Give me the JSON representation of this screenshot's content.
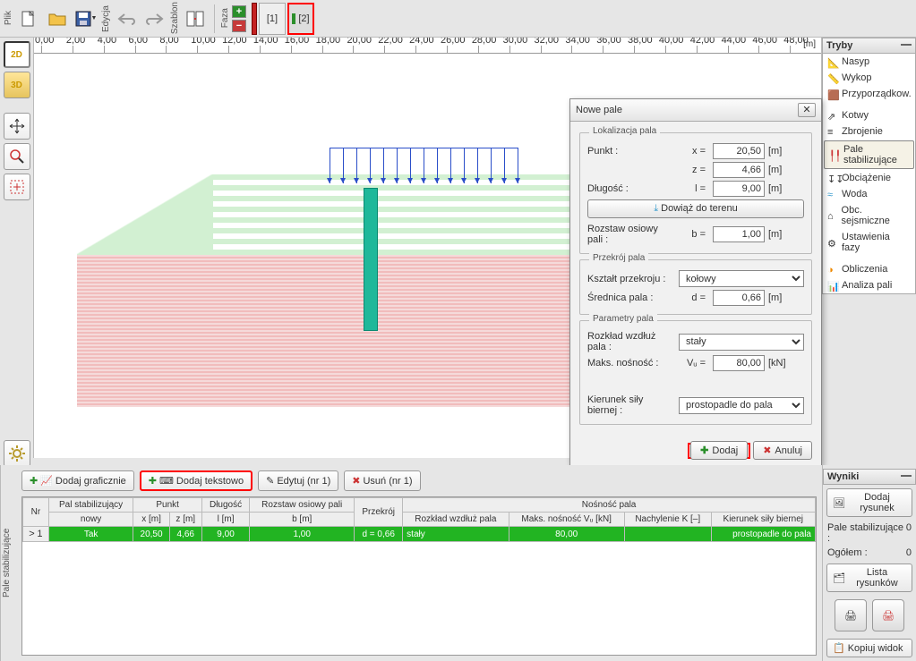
{
  "toolbar_labels": {
    "plik": "Plik",
    "edycja": "Edycja",
    "szablon": "Szablon",
    "faza": "Faza"
  },
  "phases": {
    "p1": "[1]",
    "p2": "[2]"
  },
  "ruler": {
    "unit": "[m]",
    "ticks": [
      "0,00",
      "2,00",
      "4,00",
      "6,00",
      "8,00",
      "10,00",
      "12,00",
      "14,00",
      "16,00",
      "18,00",
      "20,00",
      "22,00",
      "24,00",
      "26,00",
      "28,00",
      "30,00",
      "32,00",
      "34,00",
      "36,00",
      "38,00",
      "40,00",
      "42,00",
      "44,00",
      "46,00",
      "48,00"
    ]
  },
  "modes": {
    "title": "Tryby",
    "items": [
      "Nasyp",
      "Wykop",
      "Przyporządkow.",
      "Kotwy",
      "Zbrojenie",
      "Pale stabilizujące",
      "Obciążenie",
      "Woda",
      "Obc. sejsmiczne",
      "Ustawienia fazy",
      "Obliczenia",
      "Analiza pali"
    ],
    "sel_index": 5
  },
  "results": {
    "title": "Wyniki",
    "add": "Dodaj rysunek",
    "r1l": "Pale stabilizujące :",
    "r1v": "0",
    "r2l": "Ogółem :",
    "r2v": "0",
    "list": "Lista rysunków",
    "copy": "Kopiuj widok"
  },
  "dialog": {
    "title": "Nowe pale",
    "g1": "Lokalizacja pala",
    "punkt": "Punkt :",
    "xeq": "x =",
    "xval": "20,50",
    "mu": "[m]",
    "zeq": "z =",
    "zval": "4,66",
    "dlugosc": "Długość :",
    "leq": "l =",
    "lval": "9,00",
    "dowiaz": "Dowiąż do terenu",
    "rozstaw": "Rozstaw osiowy pali :",
    "beq": "b =",
    "bval": "1,00",
    "g2": "Przekrój pala",
    "ksztalt": "Kształt przekroju :",
    "ksztalt_val": "kołowy",
    "srednica": "Średnica pala :",
    "deq": "d =",
    "dval": "0,66",
    "g3": "Parametry pala",
    "rozklad": "Rozkład wzdłuż pala :",
    "rozklad_val": "stały",
    "maks": "Maks. nośność :",
    "veq": "Vᵤ =",
    "vval": "80,00",
    "kn": "[kN]",
    "kierunek": "Kierunek siły biernej :",
    "kierunek_val": "prostopadle do pala",
    "ok": "Dodaj",
    "cancel": "Anuluj"
  },
  "bottom": {
    "side": "Pale stabilizujące",
    "b1": "Dodaj graficznie",
    "b2": "Dodaj tekstowo",
    "b3": "Edytuj (nr 1)",
    "b4": "Usuń (nr 1)",
    "hdr": {
      "nr": "Nr",
      "pal": "Pal stabilizujący",
      "nowy": "nowy",
      "punkt": "Punkt",
      "xm": "x [m]",
      "zm": "z [m]",
      "dl": "Długość",
      "lm": "l [m]",
      "roz": "Rozstaw osiowy pali",
      "bm": "b [m]",
      "prz": "Przekrój",
      "nos": "Nośność pala",
      "rwp": "Rozkład wzdłuż pala",
      "mvu": "Maks. nośność Vᵤ [kN]",
      "nk": "Nachylenie K [–]",
      "ksb": "Kierunek siły biernej"
    },
    "row": {
      "nr": "1",
      "pal": "Tak",
      "x": "20,50",
      "z": "4,66",
      "l": "9,00",
      "b": "1,00",
      "prz": "d = 0,66",
      "rwp": "stały",
      "mvu": "80,00",
      "nk": "",
      "ksb": "prostopadle do pala",
      "marker": ">"
    }
  },
  "left": {
    "t2d": "2D",
    "t3d": "3D"
  }
}
